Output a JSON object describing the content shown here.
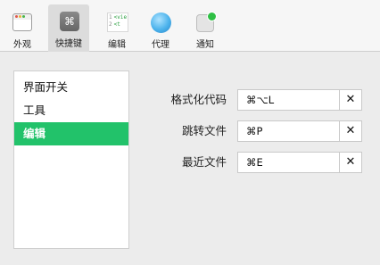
{
  "toolbar": {
    "items": [
      {
        "label": "外观",
        "icon": "appearance-icon"
      },
      {
        "label": "快捷键",
        "icon": "command-key-icon",
        "glyph": "⌘",
        "active": true
      },
      {
        "label": "编辑",
        "icon": "code-editor-icon",
        "code_lines": [
          {
            "n": "1",
            "text": "<vie"
          },
          {
            "n": "2",
            "text": "<t"
          }
        ]
      },
      {
        "label": "代理",
        "icon": "globe-icon"
      },
      {
        "label": "通知",
        "icon": "notification-icon"
      }
    ]
  },
  "sidebar": {
    "items": [
      {
        "label": "界面开关"
      },
      {
        "label": "工具"
      },
      {
        "label": "编辑",
        "selected": true
      }
    ]
  },
  "shortcuts": [
    {
      "label": "格式化代码",
      "value": "⌘⌥L",
      "clear": "✕"
    },
    {
      "label": "跳转文件",
      "value": "⌘P",
      "clear": "✕"
    },
    {
      "label": "最近文件",
      "value": "⌘E",
      "clear": "✕"
    }
  ],
  "colors": {
    "accent": "#22c26a",
    "notify_dot": "#2fbf45"
  }
}
